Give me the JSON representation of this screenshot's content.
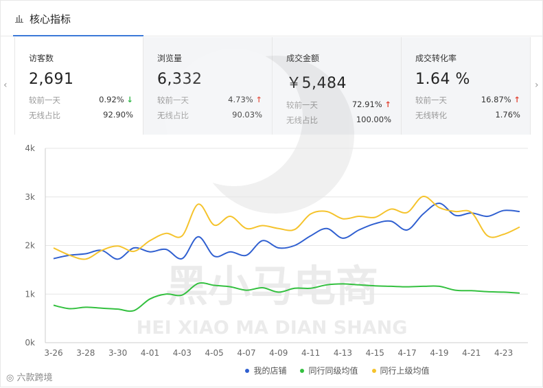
{
  "header": {
    "title": "核心指标"
  },
  "nav": {
    "prev": "‹",
    "next": "›"
  },
  "cards": [
    {
      "label": "访客数",
      "value": "2,691",
      "r1_label": "较前一天",
      "r1_value": "0.92%",
      "r1_dir": "↓",
      "r2_label": "无线占比",
      "r2_value": "92.90%"
    },
    {
      "label": "浏览量",
      "value": "6,332",
      "r1_label": "较前一天",
      "r1_value": "4.73%",
      "r1_dir": "↑",
      "r2_label": "无线占比",
      "r2_value": "90.03%"
    },
    {
      "label": "成交金额",
      "value": "￥5,484",
      "r1_label": "较前一天",
      "r1_value": "72.91%",
      "r1_dir": "↑",
      "r2_label": "无线占比",
      "r2_value": "100.00%"
    },
    {
      "label": "成交转化率",
      "value": "1.64 %",
      "r1_label": "较前一天",
      "r1_value": "16.87%",
      "r1_dir": "↑",
      "r2_label": "无线转化",
      "r2_value": "1.76%"
    }
  ],
  "watermark": {
    "cn": "黑小马电商",
    "en": "HEI XIAO MA DIAN SHANG"
  },
  "brand": "六款跨境",
  "chart_data": {
    "type": "line",
    "x": [
      "3-26",
      "3-27",
      "3-28",
      "3-29",
      "3-30",
      "3-31",
      "4-01",
      "4-02",
      "4-03",
      "4-04",
      "4-05",
      "4-06",
      "4-07",
      "4-08",
      "4-09",
      "4-10",
      "4-11",
      "4-12",
      "4-13",
      "4-14",
      "4-15",
      "4-16",
      "4-17",
      "4-18",
      "4-19",
      "4-20",
      "4-21",
      "4-22",
      "4-23",
      "4-24"
    ],
    "xticks": [
      "3-26",
      "3-28",
      "3-30",
      "4-01",
      "4-03",
      "4-05",
      "4-07",
      "4-09",
      "4-11",
      "4-13",
      "4-15",
      "4-17",
      "4-19",
      "4-21",
      "4-23"
    ],
    "yticks": [
      "0k",
      "1k",
      "2k",
      "3k",
      "4k"
    ],
    "ylim": [
      0,
      4000
    ],
    "grid": true,
    "legend_position": "bottom",
    "series": [
      {
        "name": "我的店铺",
        "color": "#2f5fd0",
        "values": [
          1730,
          1800,
          1830,
          1900,
          1720,
          1950,
          1870,
          1920,
          1730,
          2180,
          1780,
          1870,
          1800,
          2100,
          1950,
          2000,
          2200,
          2350,
          2150,
          2320,
          2450,
          2500,
          2320,
          2650,
          2870,
          2620,
          2670,
          2600,
          2720,
          2700
        ]
      },
      {
        "name": "同行同级均值",
        "color": "#33c03f",
        "values": [
          770,
          700,
          730,
          710,
          690,
          660,
          900,
          1000,
          980,
          1220,
          1180,
          1150,
          1080,
          1130,
          1040,
          1120,
          1120,
          1190,
          1210,
          1190,
          1170,
          1160,
          1150,
          1160,
          1160,
          1080,
          1070,
          1050,
          1040,
          1020
        ]
      },
      {
        "name": "同行上级均值",
        "color": "#f5c32c",
        "values": [
          1950,
          1800,
          1720,
          1900,
          1990,
          1880,
          2100,
          2250,
          2200,
          2850,
          2420,
          2600,
          2350,
          2410,
          2350,
          2330,
          2650,
          2700,
          2550,
          2600,
          2580,
          2750,
          2680,
          3010,
          2780,
          2700,
          2680,
          2200,
          2230,
          2380
        ]
      }
    ]
  }
}
